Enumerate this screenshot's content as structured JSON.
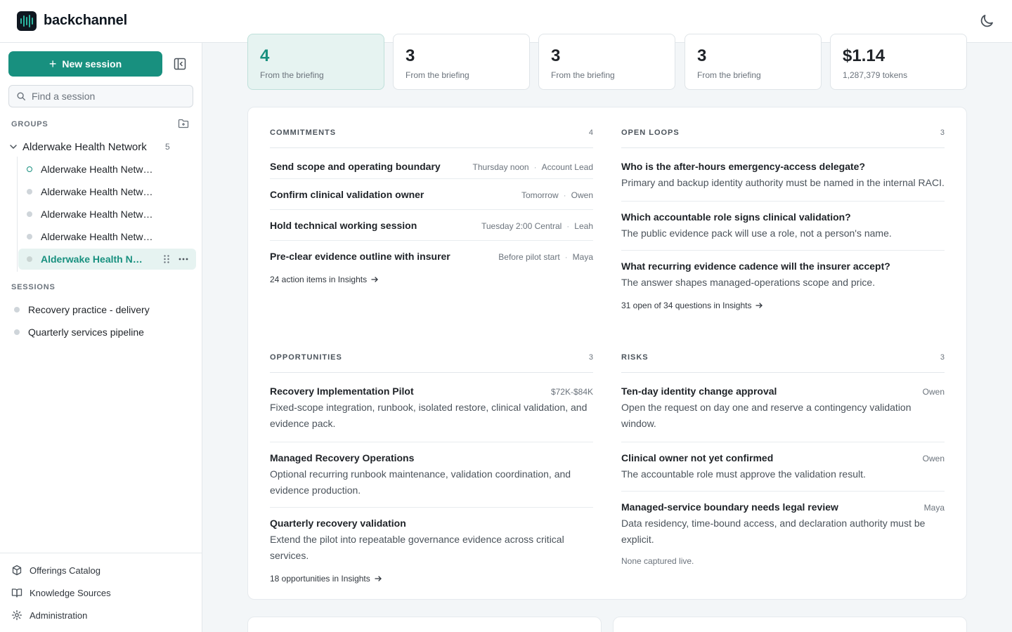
{
  "app": {
    "brand": "backchannel"
  },
  "sidebar": {
    "new_session_label": "New session",
    "search_placeholder": "Find a session",
    "groups_label": "GROUPS",
    "group": {
      "name": "Alderwake Health Network",
      "count": "5"
    },
    "group_items": [
      {
        "label": "Alderwake Health Network"
      },
      {
        "label": "Alderwake Health Network"
      },
      {
        "label": "Alderwake Health Network"
      },
      {
        "label": "Alderwake Health Network"
      },
      {
        "label": "Alderwake Health Network"
      }
    ],
    "sessions_label": "SESSIONS",
    "sessions": [
      {
        "label": "Recovery practice - delivery"
      },
      {
        "label": "Quarterly services pipeline"
      }
    ],
    "footer": [
      {
        "label": "Offerings Catalog",
        "icon": "cube-icon"
      },
      {
        "label": "Knowledge Sources",
        "icon": "book-icon"
      },
      {
        "label": "Administration",
        "icon": "gear-icon"
      }
    ]
  },
  "stats": [
    {
      "value": "4",
      "sub": "From the briefing"
    },
    {
      "value": "3",
      "sub": "From the briefing"
    },
    {
      "value": "3",
      "sub": "From the briefing"
    },
    {
      "value": "3",
      "sub": "From the briefing"
    },
    {
      "value": "$1.14",
      "sub": "1,287,379 tokens"
    }
  ],
  "commitments": {
    "title": "COMMITMENTS",
    "count": "4",
    "items": [
      {
        "title": "Send scope and operating boundary",
        "when": "Thursday noon",
        "who": "Account Lead"
      },
      {
        "title": "Confirm clinical validation owner",
        "when": "Tomorrow",
        "who": "Owen"
      },
      {
        "title": "Hold technical working session",
        "when": "Tuesday 2:00 Central",
        "who": "Leah"
      },
      {
        "title": "Pre-clear evidence outline with insurer",
        "when": "Before pilot start",
        "who": "Maya"
      }
    ],
    "link": "24 action items in Insights"
  },
  "open_loops": {
    "title": "OPEN LOOPS",
    "count": "3",
    "items": [
      {
        "title": "Who is the after-hours emergency-access delegate?",
        "desc": "Primary and backup identity authority must be named in the internal RACI."
      },
      {
        "title": "Which accountable role signs clinical validation?",
        "desc": "The public evidence pack will use a role, not a person's name."
      },
      {
        "title": "What recurring evidence cadence will the insurer accept?",
        "desc": "The answer shapes managed-operations scope and price."
      }
    ],
    "link": "31 open of 34 questions in Insights"
  },
  "opportunities": {
    "title": "OPPORTUNITIES",
    "count": "3",
    "items": [
      {
        "title": "Recovery Implementation Pilot",
        "meta": "$72K-$84K",
        "desc": "Fixed-scope integration, runbook, isolated restore, clinical validation, and evidence pack."
      },
      {
        "title": "Managed Recovery Operations",
        "meta": "",
        "desc": "Optional recurring runbook maintenance, validation coordination, and evidence production."
      },
      {
        "title": "Quarterly recovery validation",
        "meta": "",
        "desc": "Extend the pilot into repeatable governance evidence across critical services."
      }
    ],
    "link": "18 opportunities in Insights"
  },
  "risks": {
    "title": "RISKS",
    "count": "3",
    "items": [
      {
        "title": "Ten-day identity change approval",
        "meta": "Owen",
        "desc": "Open the request on day one and reserve a contingency validation window."
      },
      {
        "title": "Clinical owner not yet confirmed",
        "meta": "Owen",
        "desc": "The accountable role must approve the validation result."
      },
      {
        "title": "Managed-service boundary needs legal review",
        "meta": "Maya",
        "desc": "Data residency, time-bound access, and declaration authority must be explicit."
      }
    ],
    "note": "None captured live."
  },
  "colors": {
    "accent": "#18907f",
    "accent_bg": "#e6f3f1",
    "page_bg": "#f3f6f8"
  }
}
